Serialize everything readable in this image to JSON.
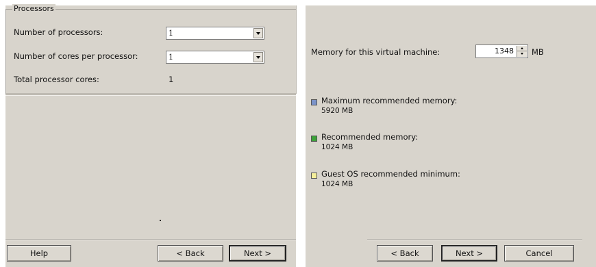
{
  "processors_panel": {
    "group_title": "Processors",
    "num_processors_label": "Number of processors:",
    "num_processors_value": "1",
    "cores_per_processor_label": "Number of cores per processor:",
    "cores_per_processor_value": "1",
    "total_cores_label": "Total processor cores:",
    "total_cores_value": "1",
    "buttons": {
      "help": "Help",
      "back": "< Back",
      "next": "Next >"
    }
  },
  "memory_panel": {
    "memory_label": "Memory for this virtual machine:",
    "memory_value": "1348",
    "memory_unit": "MB",
    "legend": [
      {
        "label": "Maximum recommended memory:",
        "value": "5920 MB",
        "color": "#7b93c9",
        "icon": "blue-square-icon"
      },
      {
        "label": "Recommended memory:",
        "value": "1024 MB",
        "color": "#3da33a",
        "icon": "green-square-icon"
      },
      {
        "label": "Guest OS recommended minimum:",
        "value": "1024 MB",
        "color": "#f4ee9a",
        "icon": "yellow-square-icon"
      }
    ],
    "buttons": {
      "back": "< Back",
      "next": "Next >",
      "cancel": "Cancel"
    }
  }
}
